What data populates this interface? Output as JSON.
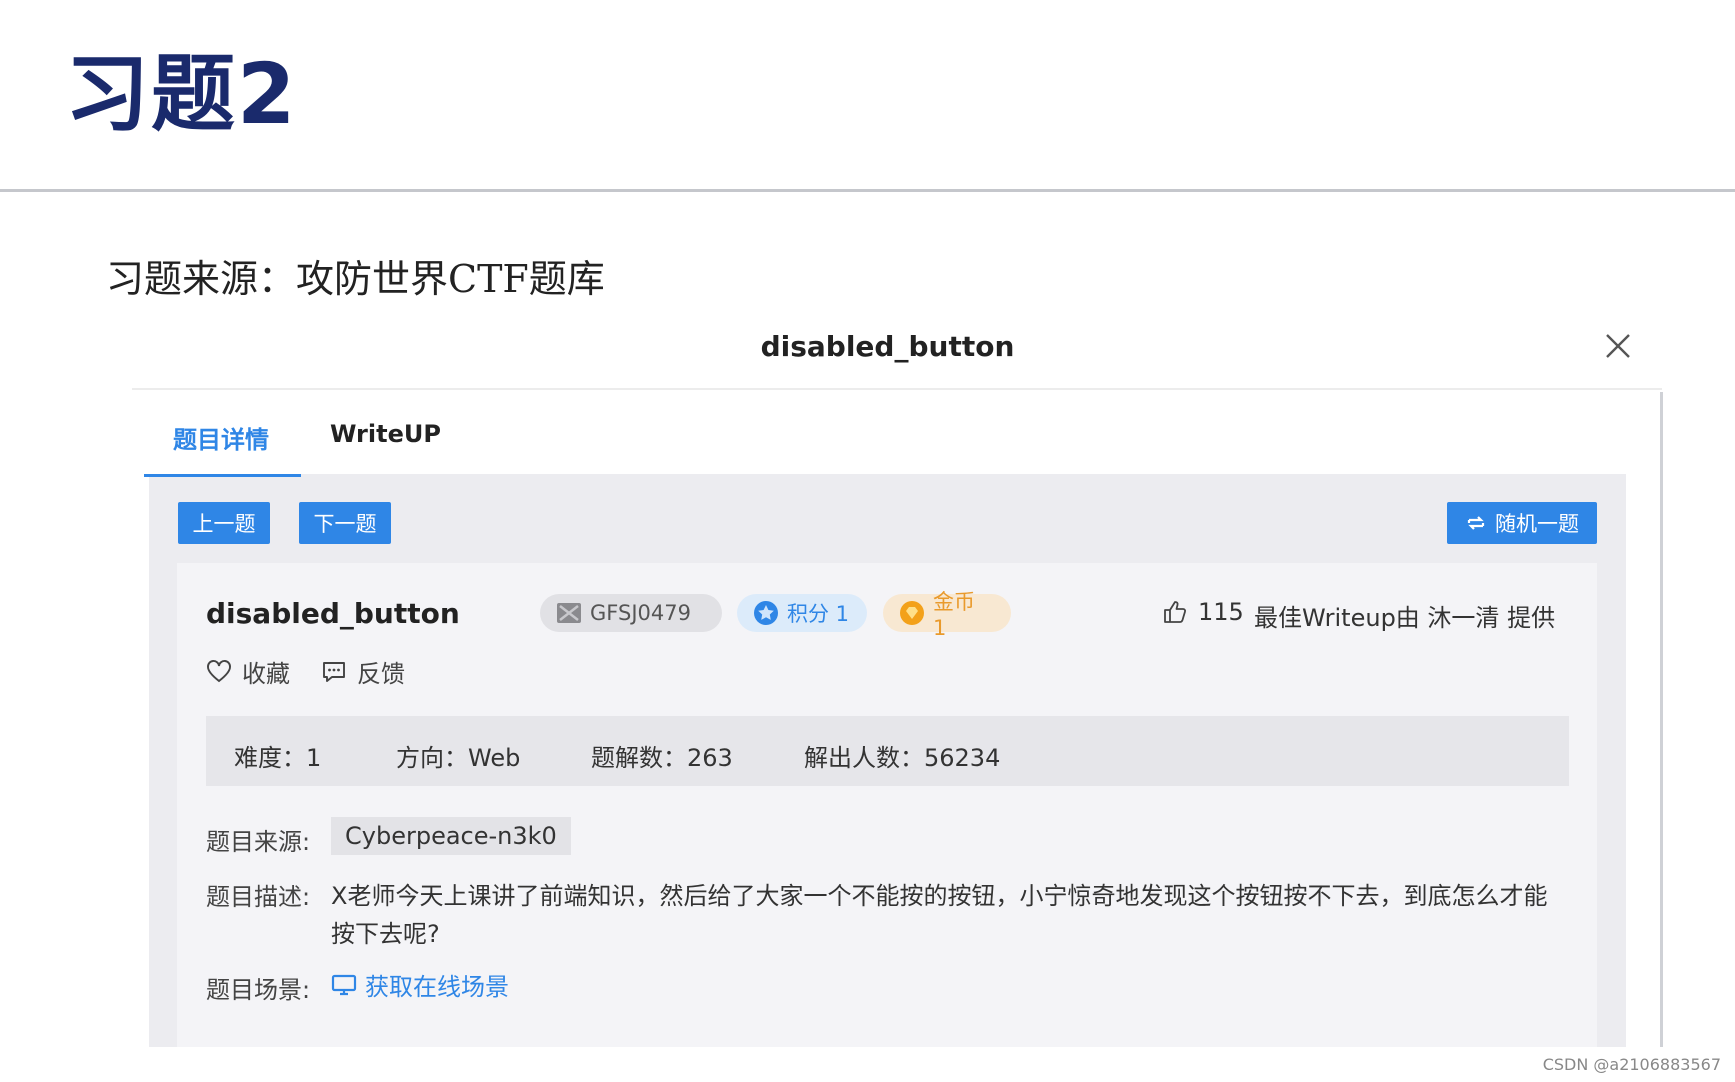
{
  "slide": {
    "title": "习题2",
    "subtitle": "习题来源：攻防世界CTF题库"
  },
  "dialog": {
    "title": "disabled_button",
    "tabs": [
      {
        "label": "题目详情",
        "active": true
      },
      {
        "label": "WriteUP",
        "active": false
      }
    ],
    "nav": {
      "prev_label": "上一题",
      "next_label": "下一题",
      "random_label": "随机一题"
    },
    "challenge": {
      "name": "disabled_button",
      "id_badge": "GFSJ0479",
      "points_badge": "积分 1",
      "coins_badge": "金币 1",
      "likes": "115",
      "best_writeup": "最佳Writeup由 沐一清 提供",
      "favorite_label": "收藏",
      "feedback_label": "反馈"
    },
    "stats": {
      "difficulty": "难度：1",
      "direction": "方向：Web",
      "solutions": "题解数：263",
      "solvers": "解出人数：56234"
    },
    "fields": {
      "source_label": "题目来源:",
      "source_value": "Cyberpeace-n3k0",
      "description_label": "题目描述:",
      "description_value": "X老师今天上课讲了前端知识，然后给了大家一个不能按的按钮，小宁惊奇地发现这个按钮按不下去，到底怎么才能按下去呢?",
      "scene_label": "题目场景:",
      "scene_link": "获取在线场景"
    }
  },
  "watermark": "CSDN @a2106883567",
  "colors": {
    "accent": "#2f86e6",
    "title_navy": "#1a2a6c",
    "coin_orange": "#e99a2c"
  }
}
